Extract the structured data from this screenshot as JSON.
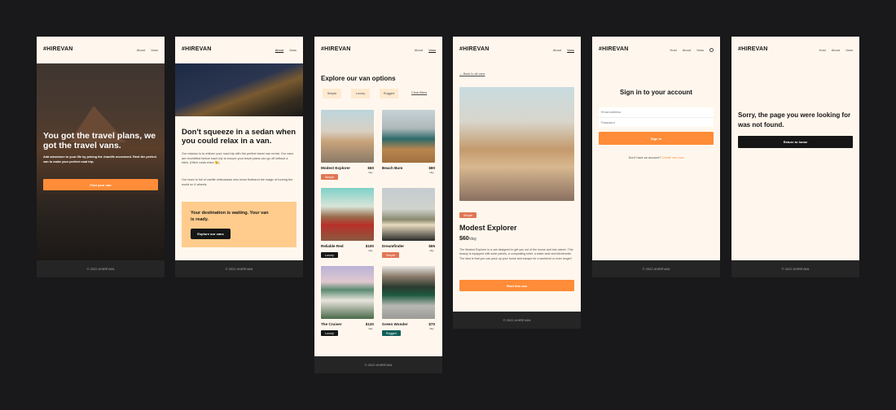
{
  "brand": "#HIREVAN",
  "footer": "© 2022 #HIREVAN",
  "colors": {
    "accent": "#ff8c38",
    "simple": "#e17654",
    "luxury": "#161616",
    "rugged": "#115e59",
    "bg": "#fff7ed"
  },
  "home": {
    "nav": [
      "About",
      "Vans"
    ],
    "headline": "You got the travel plans, we got the travel vans.",
    "sub": "Add adventure to your life by joining the #vanlife movement. Rent the perfect van to make your perfect road trip.",
    "cta": "Find your van"
  },
  "about": {
    "nav": [
      "About",
      "Vans"
    ],
    "headline": "Don't squeeze in a sedan when you could relax in a van.",
    "p1": "Our mission is to enliven your road trip with the perfect travel van rental. Our vans are recertified before each trip to ensure your travel plans can go off without a hitch. (Hitch costs extra 😉)",
    "p2": "Our team is full of vanlife enthusiasts who know firsthand the magic of touring the world on 4 wheels.",
    "box_title": "Your destination is waiting. Your van is ready.",
    "box_cta": "Explore our vans"
  },
  "vans": {
    "nav": [
      "About",
      "Vans"
    ],
    "title": "Explore our van options",
    "filters": [
      "Simple",
      "Luxury",
      "Rugged"
    ],
    "clear": "Clear filters",
    "per_day": "/day",
    "items": [
      {
        "name": "Modest Explorer",
        "price": "$60",
        "type": "Simple"
      },
      {
        "name": "Beach Bum",
        "price": "$80",
        "type": ""
      },
      {
        "name": "Reliable Red",
        "price": "$100",
        "type": "Luxury"
      },
      {
        "name": "Dreamfinder",
        "price": "$65",
        "type": "Simple"
      },
      {
        "name": "The Cruiser",
        "price": "$120",
        "type": "Luxury"
      },
      {
        "name": "Green Wonder",
        "price": "$70",
        "type": "Rugged"
      }
    ]
  },
  "detail": {
    "nav": [
      "About",
      "Vans"
    ],
    "back": "← Back to all vans",
    "badge": "Simple",
    "name": "Modest Explorer",
    "price": "$60",
    "per_day": "/day",
    "desc": "The Modest Explorer is a van designed to get you out of the house and into nature. This beauty is equipped with solar panels, a composting toilet, a water tank and kitchenette. The idea is that you can pack up your home and escape for a weekend or even longer!",
    "cta": "Rent this van"
  },
  "login": {
    "nav": [
      "Host",
      "About",
      "Vans"
    ],
    "title": "Sign in to your account",
    "email_ph": "Email address",
    "password_ph": "Password",
    "cta": "Sign in",
    "no_account": "Don't have an account?",
    "create": "Create one now"
  },
  "notfound": {
    "nav": [
      "Host",
      "About",
      "Vans"
    ],
    "title": "Sorry, the page you were looking for was not found.",
    "cta": "Return to home"
  }
}
